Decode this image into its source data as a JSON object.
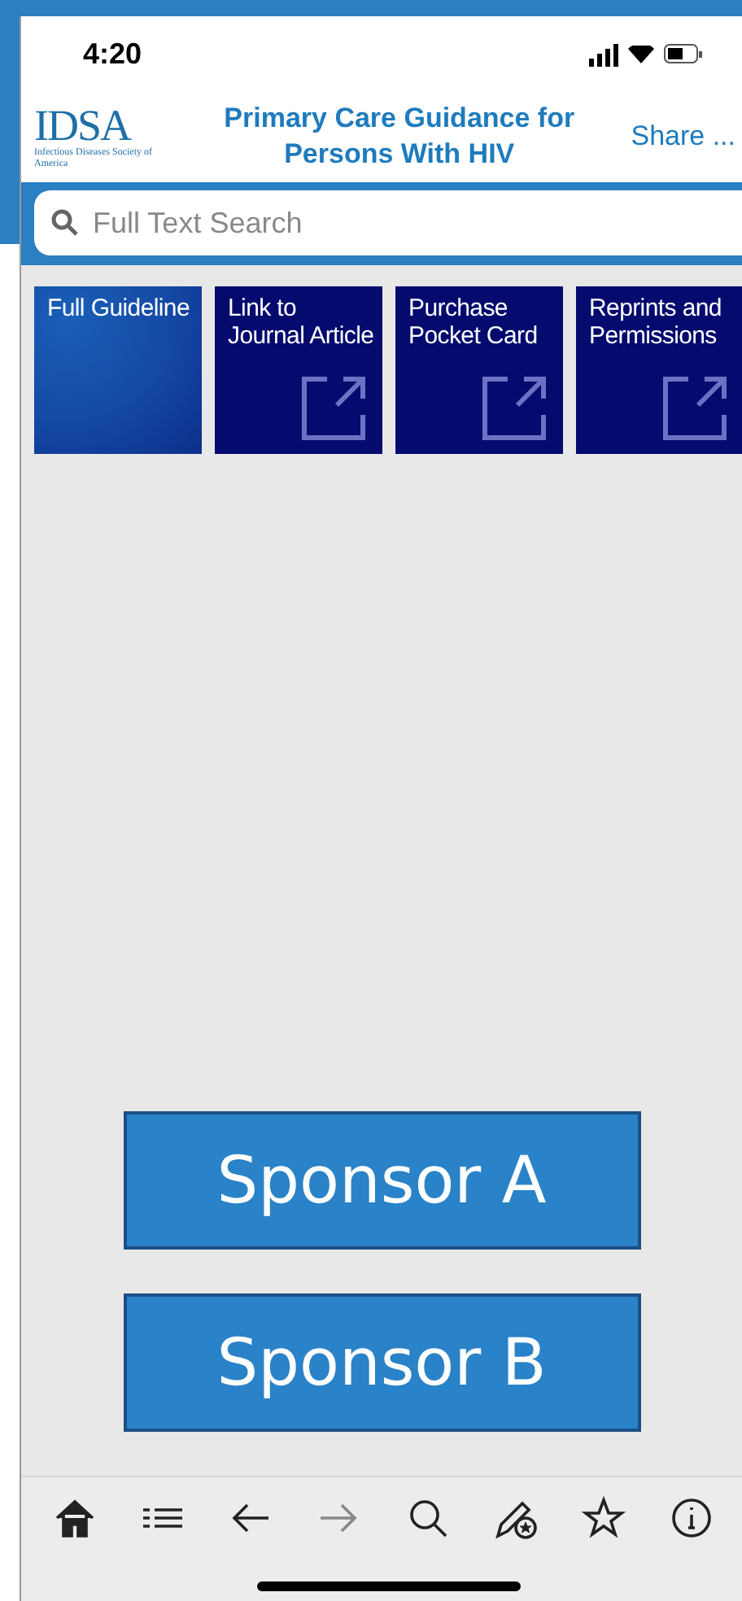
{
  "status_bar": {
    "time": "4:20"
  },
  "header": {
    "logo": "IDSA",
    "logo_subtitle": "Infectious Diseases Society of America",
    "title": "Primary Care Guidance for Persons With HIV",
    "share": "Share ..."
  },
  "search": {
    "placeholder": "Full Text Search"
  },
  "tiles": [
    {
      "label": "Full Guideline",
      "kind": "gradient"
    },
    {
      "label": "Link to Journal Article",
      "kind": "external"
    },
    {
      "label": "Purchase Pocket Card",
      "kind": "external"
    },
    {
      "label": "Reprints and Permissions",
      "kind": "external"
    }
  ],
  "sponsors": [
    "Sponsor A",
    "Sponsor B"
  ],
  "toolbar": [
    {
      "kind": "home",
      "disabled": false
    },
    {
      "kind": "list",
      "disabled": false
    },
    {
      "kind": "back",
      "disabled": false
    },
    {
      "kind": "forward",
      "disabled": true
    },
    {
      "kind": "search",
      "disabled": false
    },
    {
      "kind": "annotate",
      "disabled": false
    },
    {
      "kind": "favorite",
      "disabled": false
    },
    {
      "kind": "info",
      "disabled": false
    }
  ]
}
